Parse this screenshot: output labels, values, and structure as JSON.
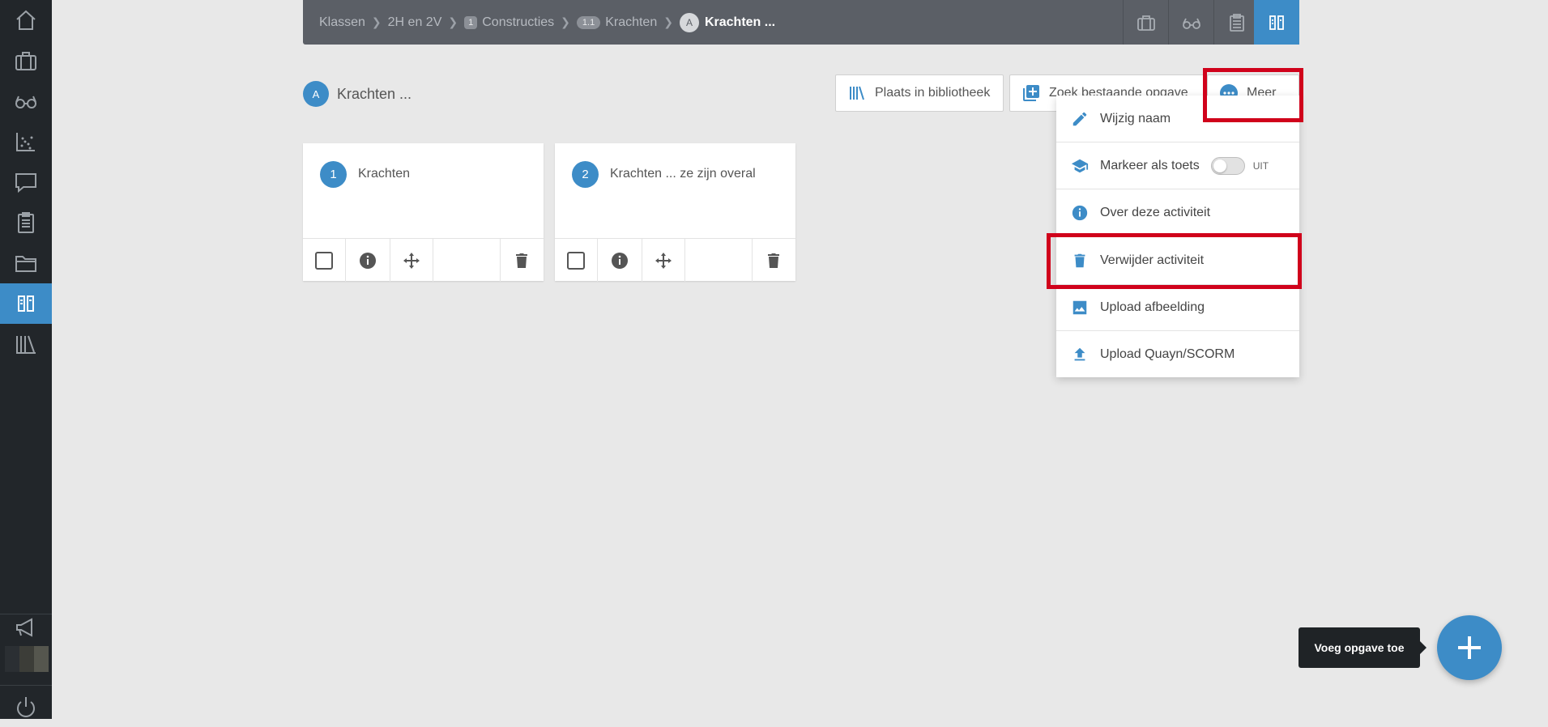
{
  "sidebar": {
    "items": [
      {
        "name": "home-icon"
      },
      {
        "name": "briefcase-icon"
      },
      {
        "name": "glasses-icon"
      },
      {
        "name": "scatter-chart-icon"
      },
      {
        "name": "chat-bubble-icon"
      },
      {
        "name": "clipboard-icon"
      },
      {
        "name": "folder-icon"
      },
      {
        "name": "method-editor-icon",
        "active": true
      },
      {
        "name": "library-icon"
      },
      {
        "name": "megaphone-icon"
      },
      {
        "name": "power-icon"
      }
    ],
    "active_color": "#3d8cc7",
    "background": "#22262a"
  },
  "breadcrumb": {
    "items": [
      {
        "label": "Klassen"
      },
      {
        "label": "2H en 2V"
      },
      {
        "chip": "1",
        "label": "Constructies"
      },
      {
        "chip": "1.1",
        "label": "Krachten"
      },
      {
        "letter": "A",
        "label": "Krachten ..."
      }
    ]
  },
  "topbar_buttons": [
    {
      "name": "briefcase-icon"
    },
    {
      "name": "glasses-icon"
    },
    {
      "name": "clipboard-icon"
    },
    {
      "name": "method-editor-icon",
      "active": true
    }
  ],
  "header": {
    "badge": "A",
    "title": "Krachten ...",
    "buttons": {
      "library": "Plaats in bibliotheek",
      "search_existing": "Zoek bestaande opgave",
      "more": "Meer"
    }
  },
  "cards": [
    {
      "number": "1",
      "title": "Krachten"
    },
    {
      "number": "2",
      "title": "Krachten ... ze zijn overal"
    }
  ],
  "dropdown": {
    "rename": "Wijzig naam",
    "mark_as_test": "Markeer als toets",
    "toggle_state": "UIT",
    "about": "Over deze activiteit",
    "delete": "Verwijder activiteit",
    "upload_image": "Upload afbeelding",
    "upload_scorm": "Upload Quayn/SCORM"
  },
  "fab": {
    "tooltip": "Voeg opgave toe"
  },
  "colors": {
    "accent": "#3d8cc7",
    "highlight": "#d0021b",
    "topbar": "#5b5f66"
  }
}
